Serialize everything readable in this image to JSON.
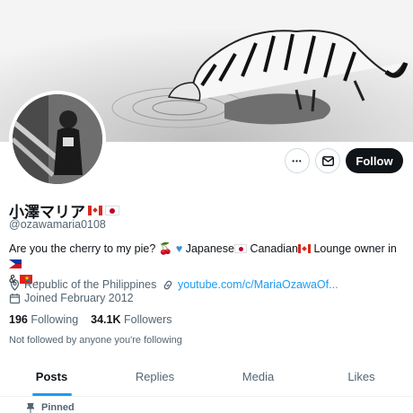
{
  "profile": {
    "name": "小澤マリア",
    "handle": "@ozawamaria0108",
    "bio": {
      "part1": "Are you the cherry to my pie?",
      "part2": "Japanese",
      "part3": "Canadian",
      "part4": "Lounge owner in",
      "part5": "&",
      "part6": "."
    },
    "location": "Republic of the Philippines",
    "website": "youtube.com/c/MariaOzawaOf...",
    "joined": "Joined February 2012"
  },
  "actions": {
    "more_label": "•••",
    "follow_label": "Follow"
  },
  "stats": {
    "following_count": "196",
    "following_label": "Following",
    "followers_count": "34.1K",
    "followers_label": "Followers"
  },
  "not_followed_text": "Not followed by anyone you're following",
  "tabs": [
    {
      "label": "Posts"
    },
    {
      "label": "Replies"
    },
    {
      "label": "Media"
    },
    {
      "label": "Likes"
    }
  ],
  "pinned_label": "Pinned",
  "colors": {
    "accent": "#1d9bf0",
    "text": "#0f1419",
    "muted": "#536471",
    "follow_bg": "#0f1419"
  }
}
